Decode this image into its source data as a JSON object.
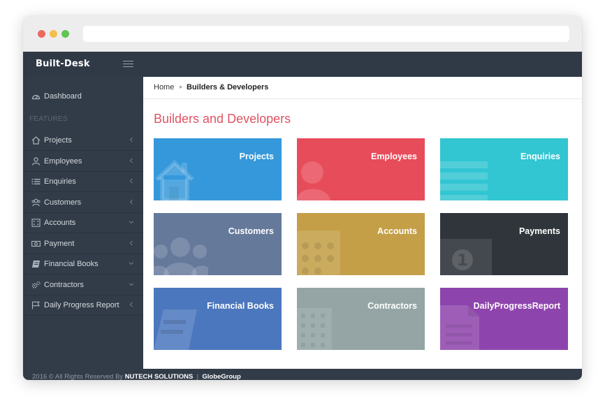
{
  "app": {
    "brand": "Built-Desk"
  },
  "sidebar": {
    "section_label": "FEATURES",
    "items": [
      {
        "label": "Dashboard",
        "icon": "dashboard-icon",
        "chevron": "none"
      },
      {
        "label": "Projects",
        "icon": "home-icon",
        "chevron": "left"
      },
      {
        "label": "Employees",
        "icon": "user-icon",
        "chevron": "left"
      },
      {
        "label": "Enquiries",
        "icon": "list-icon",
        "chevron": "left"
      },
      {
        "label": "Customers",
        "icon": "users-icon",
        "chevron": "left"
      },
      {
        "label": "Accounts",
        "icon": "calculator-icon",
        "chevron": "down"
      },
      {
        "label": "Payment",
        "icon": "money-icon",
        "chevron": "left"
      },
      {
        "label": "Financial Books",
        "icon": "book-icon",
        "chevron": "down"
      },
      {
        "label": "Contractors",
        "icon": "cogs-icon",
        "chevron": "down"
      },
      {
        "label": "Daily Progress Report",
        "icon": "flag-icon",
        "chevron": "left"
      }
    ]
  },
  "breadcrumb": {
    "home": "Home",
    "separator": "▸",
    "current": "Builders & Developers"
  },
  "page": {
    "title": "Builders and Developers"
  },
  "tiles": [
    {
      "label": "Projects",
      "color": "#3498db",
      "icon": "home-icon"
    },
    {
      "label": "Employees",
      "color": "#e74c5a",
      "icon": "user-icon"
    },
    {
      "label": "Enquiries",
      "color": "#32c5d2",
      "icon": "list-icon"
    },
    {
      "label": "Customers",
      "color": "#65799b",
      "icon": "users-icon"
    },
    {
      "label": "Accounts",
      "color": "#c49f47",
      "icon": "calculator-icon"
    },
    {
      "label": "Payments",
      "color": "#2f353b",
      "icon": "money-icon"
    },
    {
      "label": "Financial Books",
      "color": "#4b77be",
      "icon": "book-icon"
    },
    {
      "label": "Contractors",
      "color": "#95a5a6",
      "icon": "building-icon"
    },
    {
      "label": "DailyProgressReport",
      "color": "#8e44ad",
      "icon": "file-icon"
    }
  ],
  "footer": {
    "prefix": "2016 © All Rights Reserved By",
    "company": "NUTECH SOLUTIONS",
    "divider": "|",
    "group": "GlobeGroup"
  }
}
